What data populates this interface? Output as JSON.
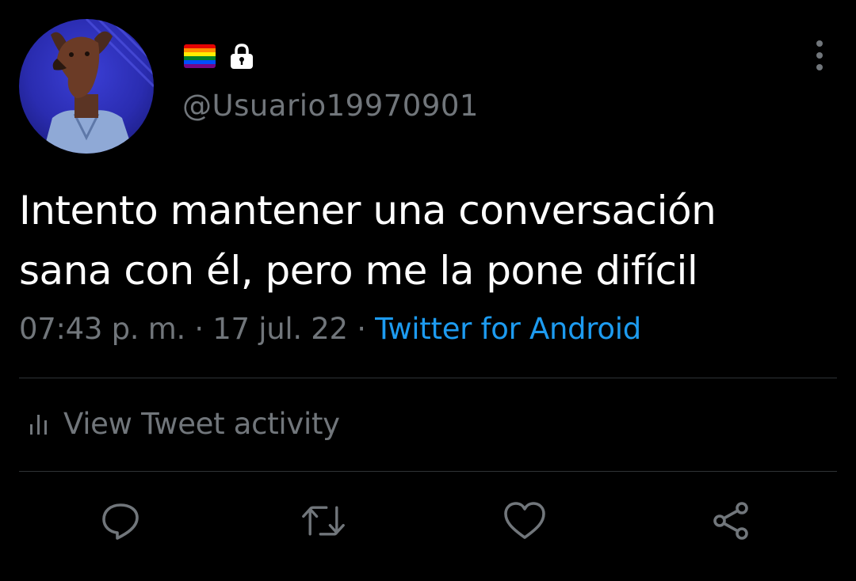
{
  "tweet": {
    "flag_icon": "rainbow-flag-icon",
    "lock_icon": "lock-icon",
    "handle": "@Usuario19970901",
    "text_line1": "Intento mantener una conversación",
    "text_line2": "sana con él, pero me la pone difícil",
    "time": "07:43 p. m.",
    "separator": " · ",
    "date": "17 jul. 22",
    "source": "Twitter for Android"
  },
  "activity": {
    "icon": "bar-chart-icon",
    "label": "View Tweet activity"
  },
  "actions": {
    "reply_icon": "reply-icon",
    "retweet_icon": "retweet-icon",
    "like_icon": "heart-icon",
    "share_icon": "share-icon"
  },
  "colors": {
    "background": "#000000",
    "text": "#ffffff",
    "secondary": "#71767b",
    "accent": "#1d9bf0",
    "divider": "#2f3336"
  }
}
